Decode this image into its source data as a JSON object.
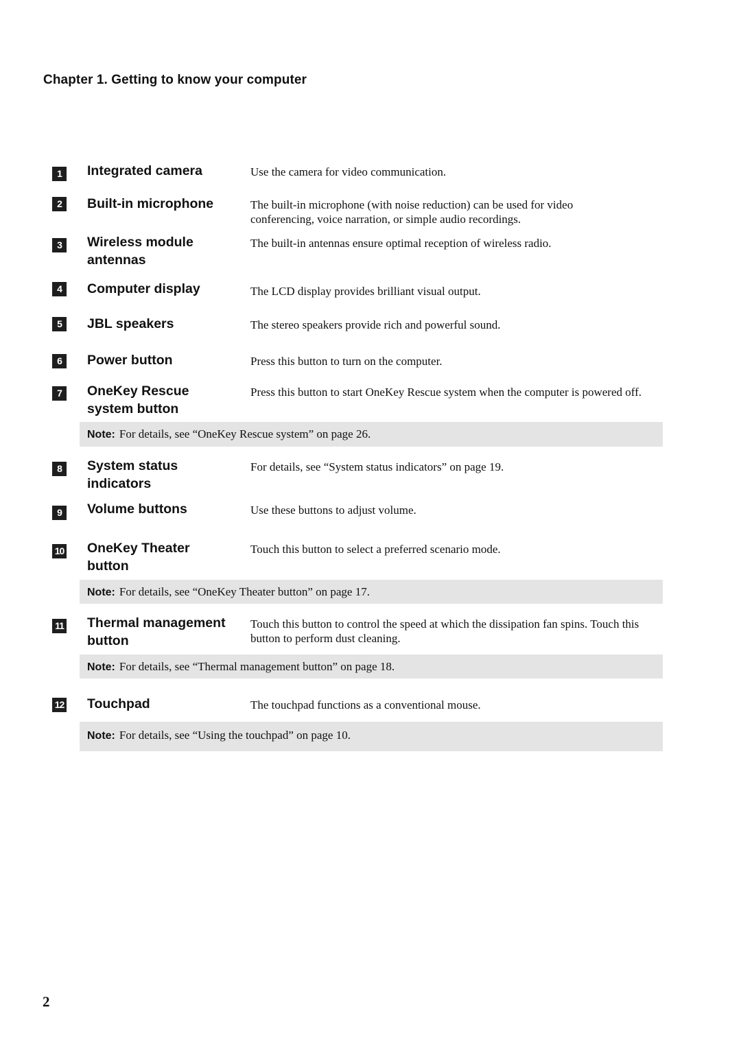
{
  "chapter_title": "Chapter 1. Getting to know your computer",
  "items": [
    {
      "number": "1",
      "term": "Integrated camera",
      "description": "Use the camera for video communication."
    },
    {
      "number": "2",
      "term": "Built-in microphone",
      "description": "The built-in microphone (with noise reduction) can be used for video conferencing, voice narration, or simple audio recordings."
    },
    {
      "number": "3",
      "term": "Wireless module antennas",
      "description": "The built-in antennas ensure optimal reception of wireless radio."
    },
    {
      "number": "4",
      "term": "Computer display",
      "description": "The LCD display provides brilliant visual output."
    },
    {
      "number": "5",
      "term": "JBL speakers",
      "description": "The stereo speakers provide rich and powerful sound."
    },
    {
      "number": "6",
      "term": "Power button",
      "description": "Press this button to turn on the computer."
    },
    {
      "number": "7",
      "term": "OneKey Rescue system button",
      "description": "Press this button to start OneKey Rescue system when the computer is powered off."
    },
    {
      "number": "8",
      "term": "System status indicators",
      "description": "For details, see “System status indicators” on page 19."
    },
    {
      "number": "9",
      "term": "Volume buttons",
      "description": "Use these buttons to adjust volume."
    },
    {
      "number": "10",
      "term": "OneKey Theater button",
      "description": "Touch this button to select a preferred scenario mode."
    },
    {
      "number": "11",
      "term": "Thermal management button",
      "description": "Touch this button to control the speed at which the dissipation fan spins. Touch this button to perform dust cleaning."
    },
    {
      "number": "12",
      "term": "Touchpad",
      "description": "The touchpad functions as a conventional mouse."
    }
  ],
  "notes": [
    {
      "label": "Note:",
      "text": "For details, see “OneKey Rescue system” on page 26."
    },
    {
      "label": "Note:",
      "text": "For details, see “OneKey Theater button” on page 17."
    },
    {
      "label": "Note:",
      "text": "For details, see “Thermal management button” on page 18."
    },
    {
      "label": "Note:",
      "text": "For details, see “Using the touchpad” on page 10."
    }
  ],
  "page_number": "2"
}
